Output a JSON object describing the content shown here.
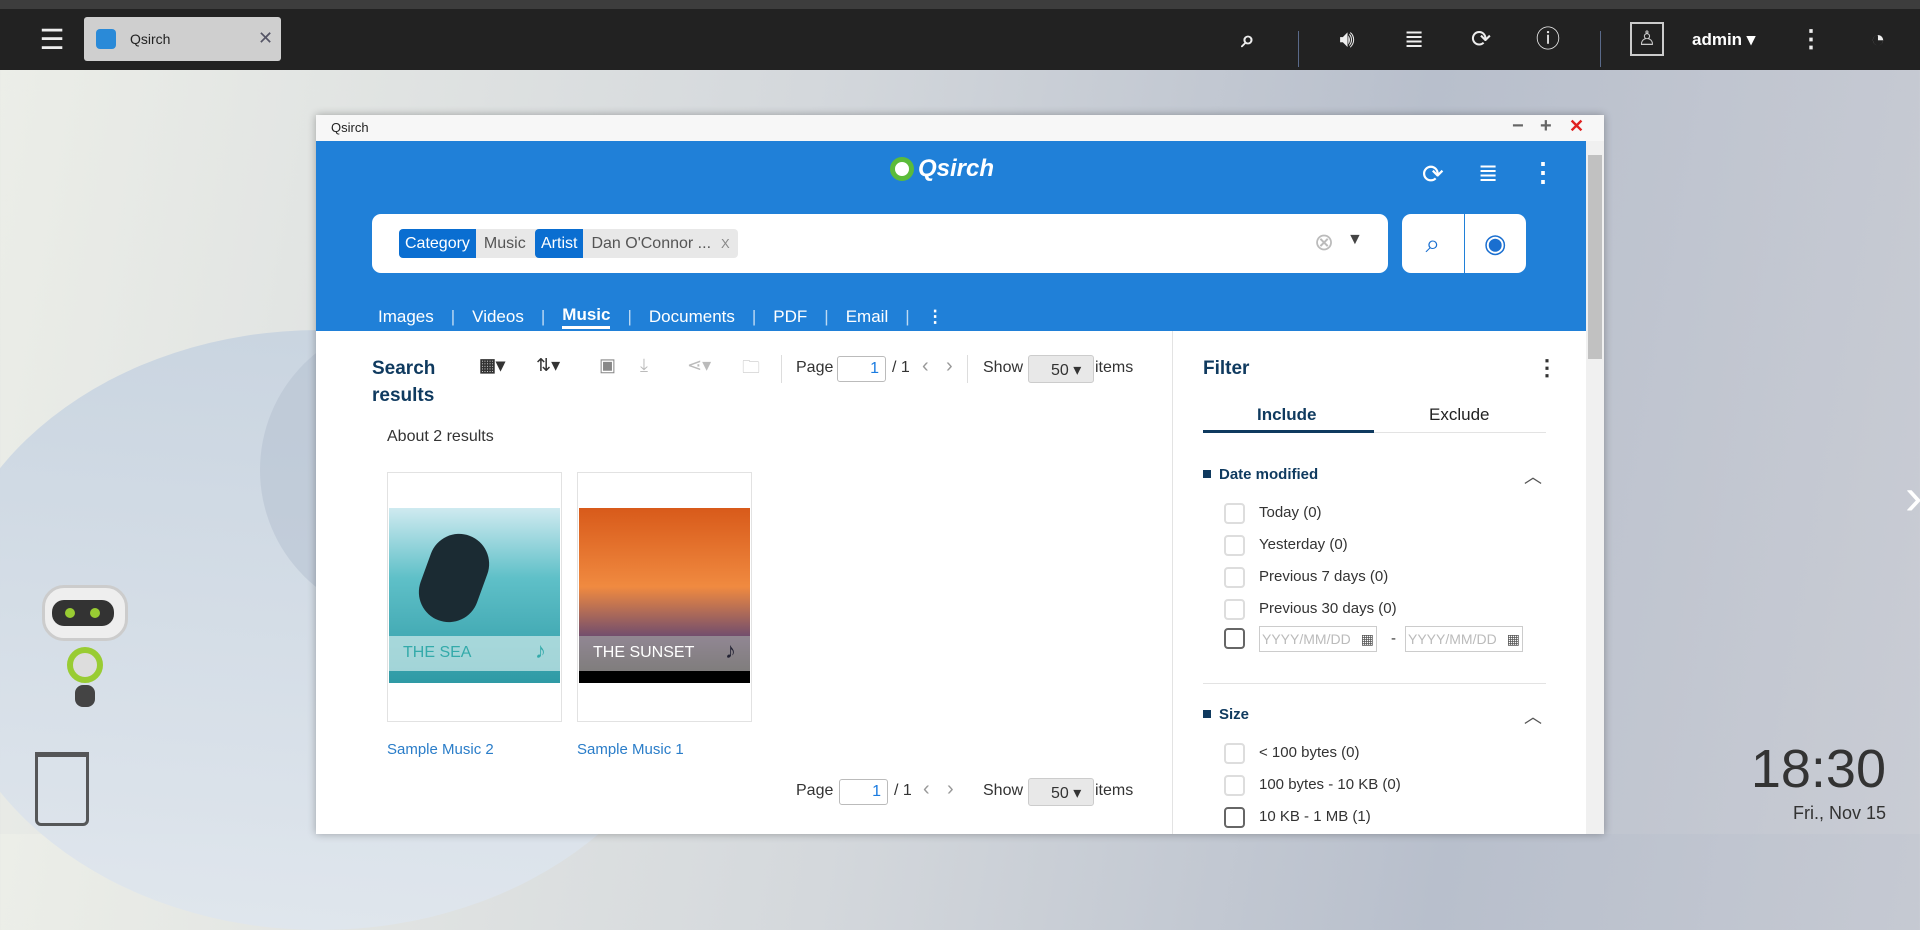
{
  "taskbar": {
    "app_tab": "Qsirch",
    "user": "admin",
    "icons": [
      "menu-icon",
      "search-icon",
      "volume-icon",
      "stack-icon",
      "sync-icon",
      "info-icon",
      "user-icon",
      "more-icon",
      "dashboard-icon"
    ]
  },
  "window": {
    "title": "Qsirch",
    "controls": [
      "minimize",
      "maximize",
      "close"
    ]
  },
  "app": {
    "logo": "Qsirch",
    "search": {
      "chips": [
        {
          "key": "Category",
          "value": "Music",
          "remove": "X"
        },
        {
          "key": "Artist",
          "value": "Dan O'Connor ...",
          "remove": "X"
        }
      ]
    },
    "categories": [
      "Images",
      "Videos",
      "Music",
      "Documents",
      "PDF",
      "Email"
    ],
    "active_category": "Music"
  },
  "results": {
    "title_line1": "Search",
    "title_line2": "results",
    "page_label": "Page",
    "page": "1",
    "page_total": "/ 1",
    "show_label": "Show",
    "per_page": "50",
    "items_label": "items",
    "count_text": "About 2 results",
    "items": [
      {
        "name": "Sample Music 2",
        "cover_text": "THE SEA"
      },
      {
        "name": "Sample Music 1",
        "cover_text": "THE SUNSET"
      }
    ]
  },
  "filter": {
    "title": "Filter",
    "tabs": [
      "Include",
      "Exclude"
    ],
    "active_tab": "Include",
    "date": {
      "title": "Date modified",
      "options": [
        "Today  (0)",
        "Yesterday  (0)",
        "Previous 7 days  (0)",
        "Previous 30 days  (0)"
      ],
      "from_placeholder": "YYYY/MM/DD",
      "to_placeholder": "YYYY/MM/DD",
      "dash": "-"
    },
    "size": {
      "title": "Size",
      "options": [
        "< 100 bytes  (0)",
        "100 bytes - 10 KB  (0)",
        "10 KB - 1 MB  (1)"
      ]
    }
  },
  "desktop": {
    "time": "18:30",
    "date": "Fri., Nov 15"
  },
  "colors": {
    "header_blue": "#2080d8",
    "chip_blue": "#0a6ed1",
    "filter_navy": "#0f3a5f",
    "link": "#2a7dc9"
  }
}
